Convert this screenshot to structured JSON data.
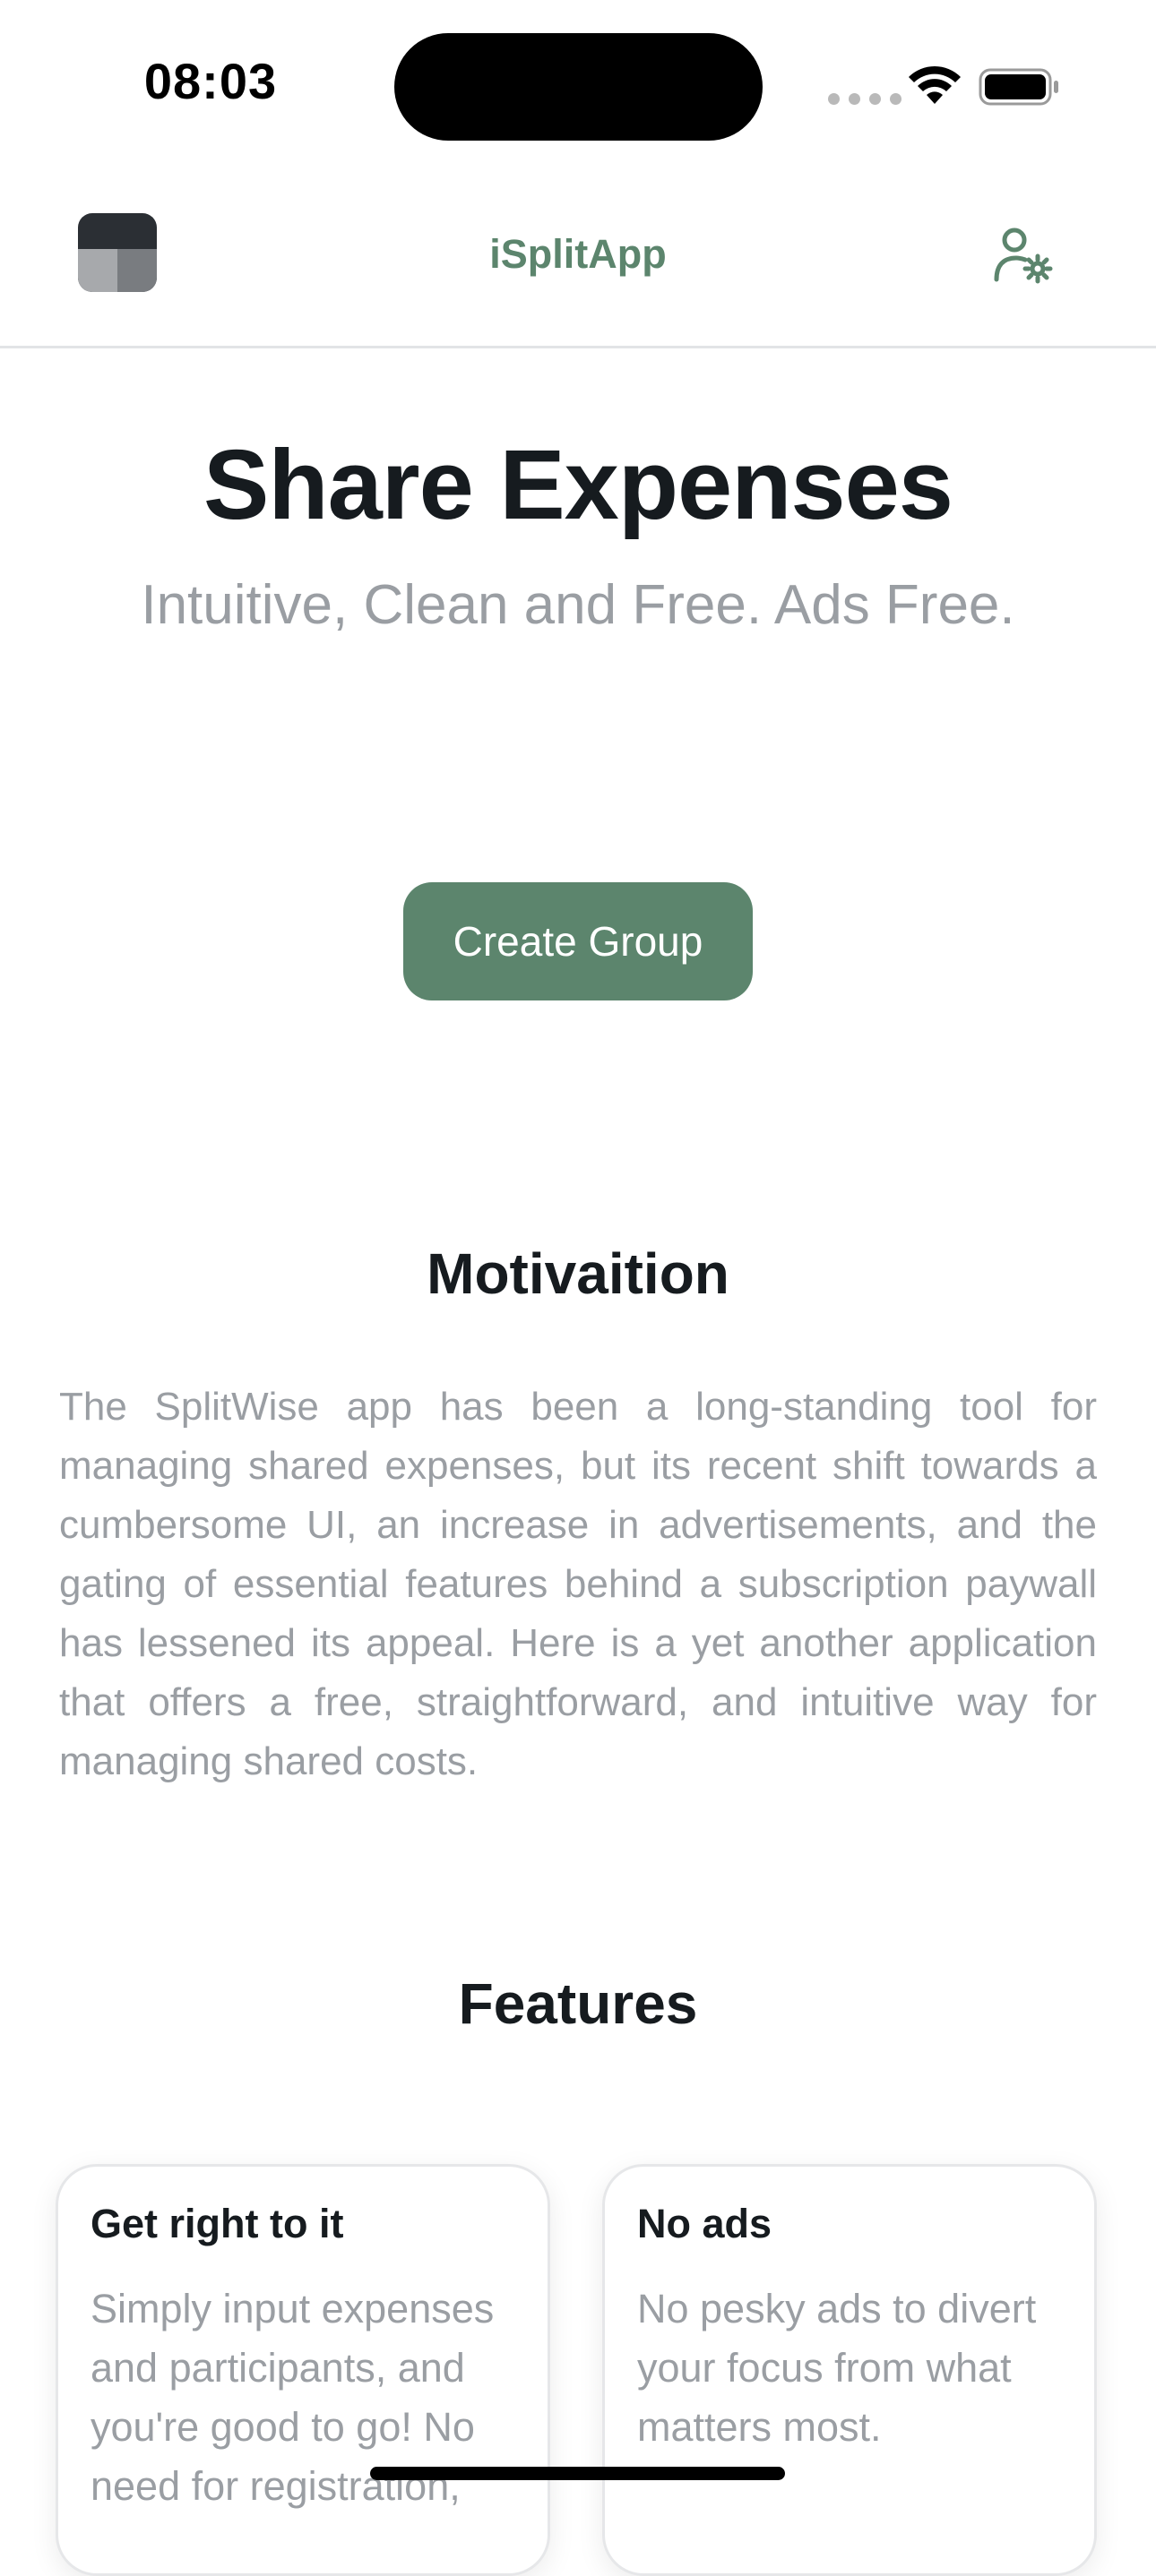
{
  "status_bar": {
    "time": "08:03"
  },
  "header": {
    "app_title": "iSplitApp",
    "logo_icon": "app-logo-icon",
    "settings_icon": "user-gear-icon"
  },
  "hero": {
    "title": "Share Expenses",
    "subtitle": "Intuitive, Clean and Free. Ads Free.",
    "cta_label": "Create Group"
  },
  "motivation": {
    "title": "Motivaition",
    "text": "The SplitWise app has been a long-standing tool for managing shared expenses, but its recent shift towards a cumbersome UI, an increase in advertisements, and the gating of essential features behind a subscription paywall has lessened its appeal. Here is a yet another application that offers a free, straightforward, and intuitive way for managing shared costs."
  },
  "features": {
    "title": "Features",
    "cards": [
      {
        "title": "Get right to it",
        "text": "Simply input expenses and participants, and you're good to go! No need for registration,"
      },
      {
        "title": "No ads",
        "text": "No pesky ads to divert your focus from what matters most."
      }
    ]
  },
  "colors": {
    "accent": "#5c856d",
    "text_primary": "#161b1f",
    "text_muted": "#9a9ea3",
    "divider": "#e2e4e6"
  }
}
